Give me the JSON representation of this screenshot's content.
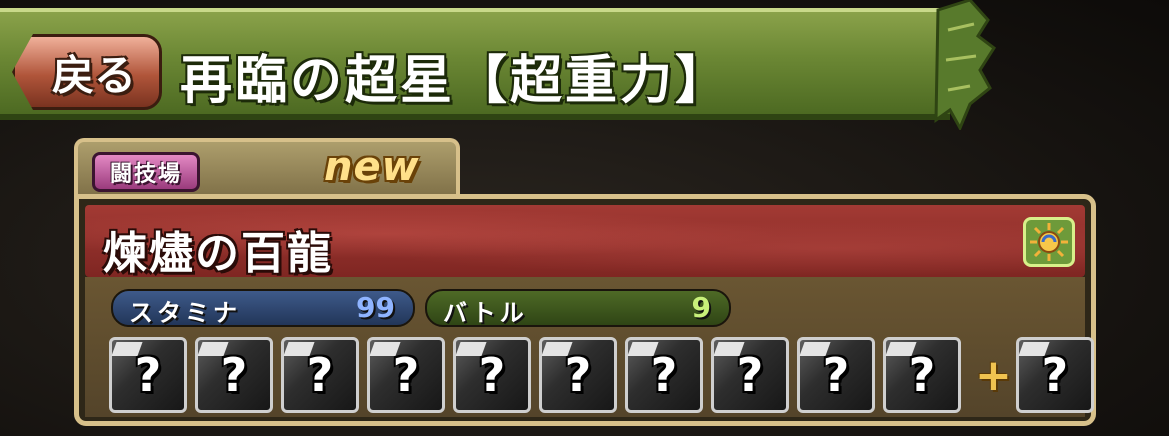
{
  "header": {
    "back_label": "戻る",
    "dungeon_title": "再臨の超星【超重力】"
  },
  "tab": {
    "category_badge": "闘技場",
    "new_label": "new"
  },
  "floor": {
    "name": "煉燼の百龍",
    "attribute_icon": "sun-icon",
    "stamina_label": "スタミナ",
    "stamina_value": "99",
    "battle_label": "バトル",
    "battle_value": "9"
  },
  "drops": {
    "slots": [
      "?",
      "?",
      "?",
      "?",
      "?",
      "?",
      "?",
      "?",
      "?",
      "?"
    ],
    "plus_label": "+",
    "extra_slot": "?"
  },
  "colors": {
    "header_green": "#6b8734",
    "panel_border": "#d7c08a",
    "name_band_red": "#a33a34",
    "stamina_blue": "#8fb4ff",
    "battle_green": "#c8f07a"
  }
}
